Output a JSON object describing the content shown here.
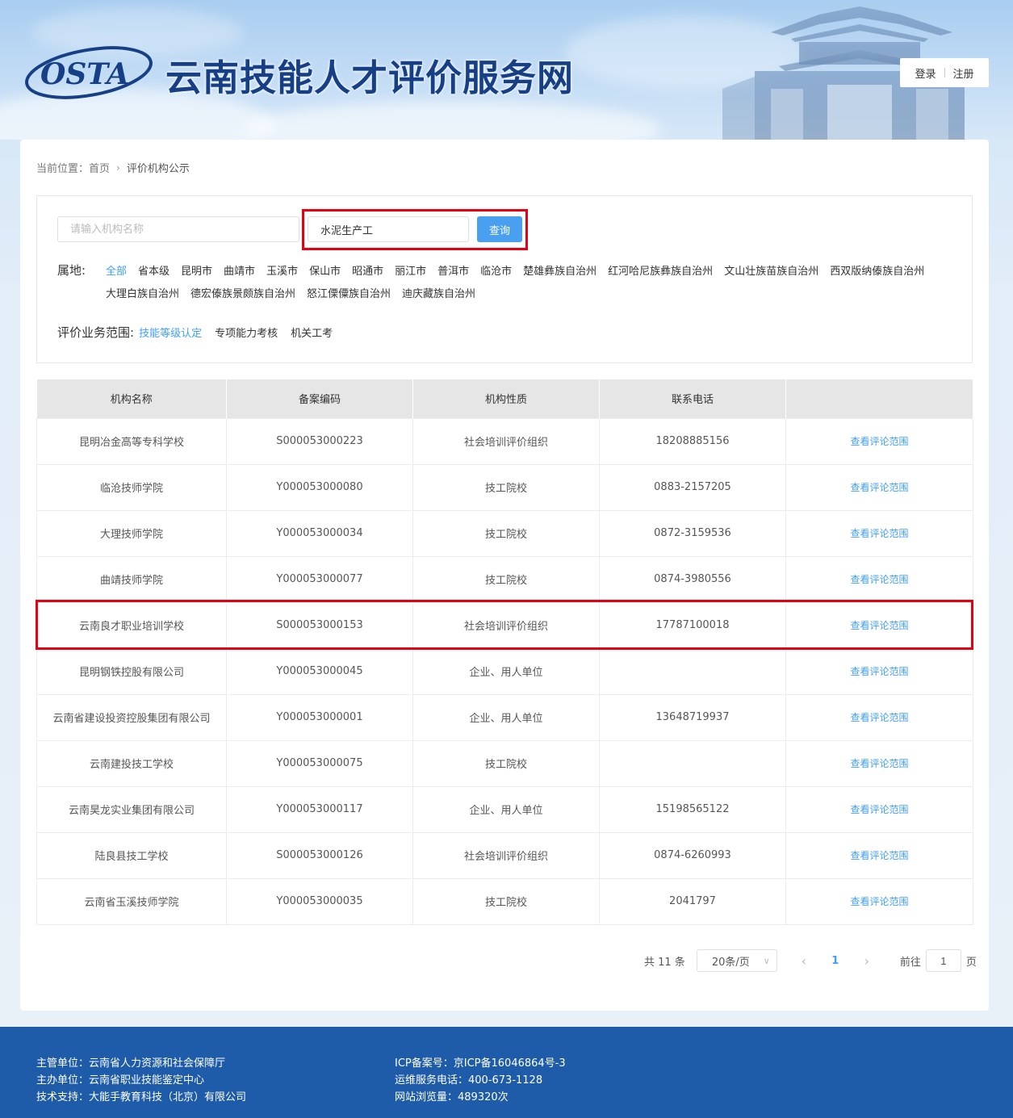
{
  "header": {
    "logo_text": "OSTA",
    "site_title": "云南技能人才评价服务网",
    "login_label": "登录",
    "register_label": "注册"
  },
  "breadcrumb": {
    "prefix": "当前位置：",
    "home": "首页",
    "current": "评价机构公示"
  },
  "search": {
    "name_placeholder": "请输入机构名称",
    "name_value": "",
    "job_value": "水泥生产工",
    "query_label": "查询"
  },
  "regions": {
    "label": "属地:",
    "items": [
      "全部",
      "省本级",
      "昆明市",
      "曲靖市",
      "玉溪市",
      "保山市",
      "昭通市",
      "丽江市",
      "普洱市",
      "临沧市",
      "楚雄彝族自治州",
      "红河哈尼族彝族自治州",
      "文山壮族苗族自治州",
      "西双版纳傣族自治州",
      "大理白族自治州",
      "德宏傣族景颇族自治州",
      "怒江傈僳族自治州",
      "迪庆藏族自治州"
    ],
    "active_index": 0
  },
  "scope": {
    "label": "评价业务范围:",
    "items": [
      "技能等级认定",
      "专项能力考核",
      "机关工考"
    ],
    "active_index": 0
  },
  "table": {
    "headers": [
      "机构名称",
      "备案编码",
      "机构性质",
      "联系电话",
      ""
    ],
    "rows": [
      {
        "name": "昆明冶金高等专科学校",
        "code": "S000053000223",
        "type": "社会培训评价组织",
        "phone": "18208885156",
        "action": "查看评论范围"
      },
      {
        "name": "临沧技师学院",
        "code": "Y000053000080",
        "type": "技工院校",
        "phone": "0883-2157205",
        "action": "查看评论范围"
      },
      {
        "name": "大理技师学院",
        "code": "Y000053000034",
        "type": "技工院校",
        "phone": "0872-3159536",
        "action": "查看评论范围"
      },
      {
        "name": "曲靖技师学院",
        "code": "Y000053000077",
        "type": "技工院校",
        "phone": "0874-3980556",
        "action": "查看评论范围"
      },
      {
        "name": "云南良才职业培训学校",
        "code": "S000053000153",
        "type": "社会培训评价组织",
        "phone": "17787100018",
        "action": "查看评论范围"
      },
      {
        "name": "昆明钢铁控股有限公司",
        "code": "Y000053000045",
        "type": "企业、用人单位",
        "phone": "",
        "action": "查看评论范围"
      },
      {
        "name": "云南省建设投资控股集团有限公司",
        "code": "Y000053000001",
        "type": "企业、用人单位",
        "phone": "13648719937",
        "action": "查看评论范围"
      },
      {
        "name": "云南建投技工学校",
        "code": "Y000053000075",
        "type": "技工院校",
        "phone": "",
        "action": "查看评论范围"
      },
      {
        "name": "云南昊龙实业集团有限公司",
        "code": "Y000053000117",
        "type": "企业、用人单位",
        "phone": "15198565122",
        "action": "查看评论范围"
      },
      {
        "name": "陆良县技工学校",
        "code": "S000053000126",
        "type": "社会培训评价组织",
        "phone": "0874-6260993",
        "action": "查看评论范围"
      },
      {
        "name": "云南省玉溪技师学院",
        "code": "Y000053000035",
        "type": "技工院校",
        "phone": "2041797",
        "action": "查看评论范围"
      }
    ],
    "highlighted_row": 4
  },
  "pagination": {
    "total": "共 11 条",
    "page_size": "20条/页",
    "current_page": "1",
    "goto_prefix": "前往",
    "goto_value": "1",
    "goto_suffix": "页"
  },
  "footer": {
    "col1": [
      "主管单位：云南省人力资源和社会保障厅",
      "主办单位：云南省职业技能鉴定中心",
      "技术支持：大能手教育科技（北京）有限公司"
    ],
    "col2": [
      "ICP备案号：京ICP备16046864号-3",
      "运维服务电话：400-673-1128",
      "网站浏览量：489320次"
    ]
  },
  "colors": {
    "accent": "#409eff",
    "button": "#4aa0f0",
    "footer_bg": "#1e5ba9",
    "highlight_border": "#e60012",
    "title": "#163f86"
  }
}
